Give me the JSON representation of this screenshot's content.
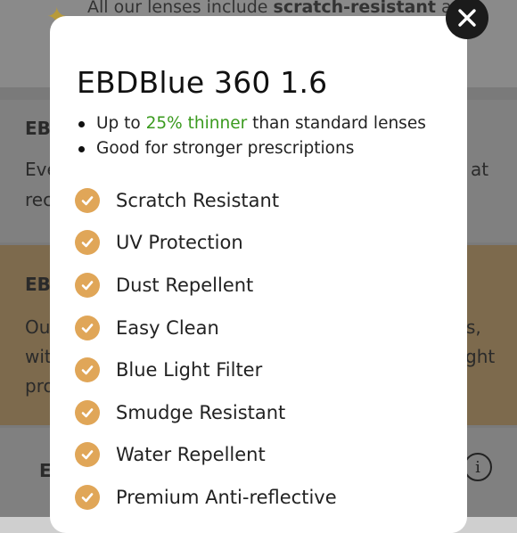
{
  "background": {
    "banner_prefix": "All our lenses include ",
    "banner_bold": "scratch-resistant",
    "banner_suffix": " and",
    "card1_title": "EB",
    "card1_line1": "Eve",
    "card1_line1_end": "at",
    "card1_line2": "rec",
    "card2_title": "EB",
    "card2_line1": "Ou",
    "card2_line1_end": "s,",
    "card2_line2": "wit",
    "card2_line2_end": "ght",
    "card2_line3": "pro",
    "card3_title": "E"
  },
  "modal": {
    "title": "EBDBlue 360 1.6",
    "bullet1_prefix": "Up to ",
    "bullet1_highlight": "25% thinner",
    "bullet1_suffix": " than standard lenses",
    "bullet2": "Good for stronger prescriptions",
    "features": [
      "Scratch Resistant",
      "UV Protection",
      "Dust Repellent",
      "Easy Clean",
      "Blue Light Filter",
      "Smudge Resistant",
      "Water Repellent",
      "Premium Anti-reflective"
    ]
  },
  "colors": {
    "accent_check": "#e0a658",
    "highlight_green": "#3a9a1e",
    "close_button": "#1b1b1b"
  },
  "icons": {
    "close": "close-icon",
    "check": "check-circle-icon",
    "info": "info-icon",
    "sparkle": "sparkle-icon"
  }
}
